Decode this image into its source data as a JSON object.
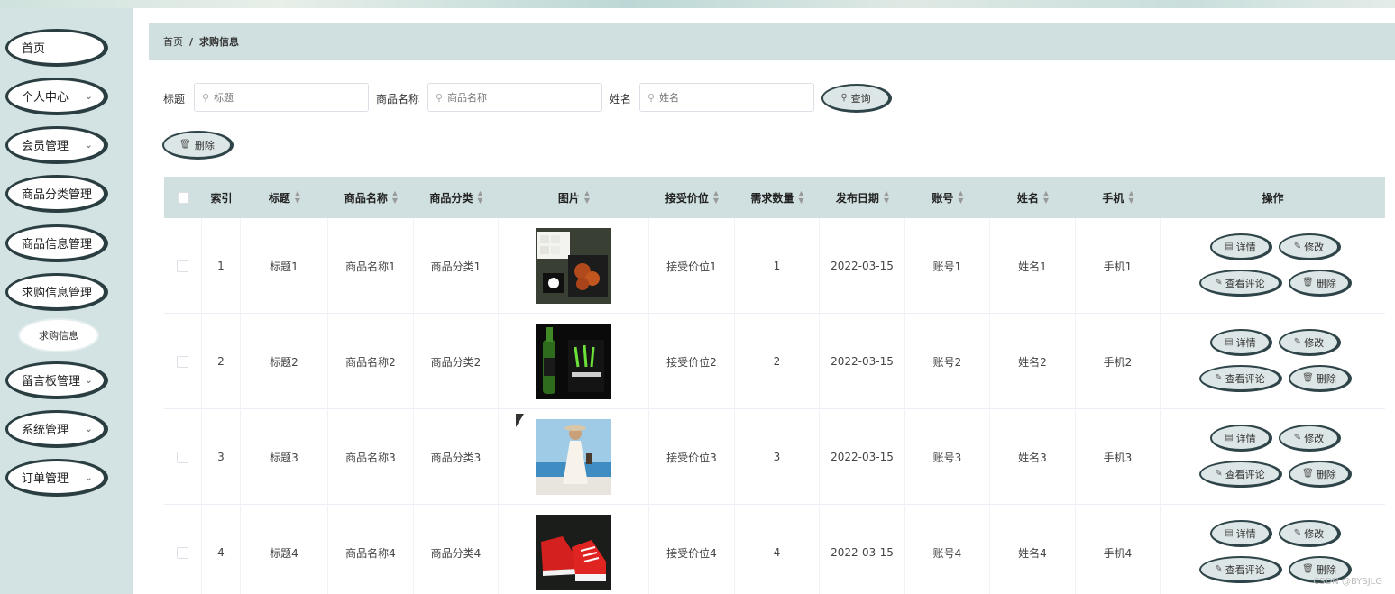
{
  "sidebar": {
    "items": [
      {
        "label": "首页",
        "chevron": false
      },
      {
        "label": "个人中心",
        "chevron": true
      },
      {
        "label": "会员管理",
        "chevron": true
      },
      {
        "label": "商品分类管理",
        "chevron": false
      },
      {
        "label": "商品信息管理",
        "chevron": false
      },
      {
        "label": "求购信息管理",
        "chevron": false
      },
      {
        "label": "留言板管理",
        "chevron": true
      },
      {
        "label": "系统管理",
        "chevron": true
      },
      {
        "label": "订单管理",
        "chevron": true
      }
    ],
    "sub_item": {
      "label": "求购信息"
    }
  },
  "breadcrumb": {
    "home": "首页",
    "separator": "/",
    "current": "求购信息"
  },
  "filters": {
    "title_label": "标题",
    "title_placeholder": "标题",
    "goods_label": "商品名称",
    "goods_placeholder": "商品名称",
    "name_label": "姓名",
    "name_placeholder": "姓名",
    "query_button": "查询"
  },
  "toolbar": {
    "delete_button": "删除"
  },
  "table": {
    "headers": {
      "index": "索引",
      "title": "标题",
      "goods_name": "商品名称",
      "goods_category": "商品分类",
      "image": "图片",
      "accept_price": "接受价位",
      "quantity": "需求数量",
      "date": "发布日期",
      "account": "账号",
      "name": "姓名",
      "phone": "手机",
      "actions": "操作"
    },
    "rows": [
      {
        "index": "1",
        "title": "标题1",
        "goods_name": "商品名称1",
        "goods_category": "商品分类1",
        "image": "food-boxes",
        "accept_price": "接受价位1",
        "quantity": "1",
        "date": "2022-03-15",
        "account": "账号1",
        "name": "姓名1",
        "phone": "手机1"
      },
      {
        "index": "2",
        "title": "标题2",
        "goods_name": "商品名称2",
        "goods_category": "商品分类2",
        "image": "energy-drink-bottle",
        "accept_price": "接受价位2",
        "quantity": "2",
        "date": "2022-03-15",
        "account": "账号2",
        "name": "姓名2",
        "phone": "手机2"
      },
      {
        "index": "3",
        "title": "标题3",
        "goods_name": "商品名称3",
        "goods_category": "商品分类3",
        "image": "woman-white-dress",
        "accept_price": "接受价位3",
        "quantity": "3",
        "date": "2022-03-15",
        "account": "账号3",
        "name": "姓名3",
        "phone": "手机3"
      },
      {
        "index": "4",
        "title": "标题4",
        "goods_name": "商品名称4",
        "goods_category": "商品分类4",
        "image": "red-sneakers",
        "accept_price": "接受价位4",
        "quantity": "4",
        "date": "2022-03-15",
        "account": "账号4",
        "name": "姓名4",
        "phone": "手机4"
      }
    ],
    "row_actions": {
      "detail": "详情",
      "edit": "修改",
      "review": "查看评论",
      "delete": "删除"
    }
  },
  "watermark": "CSDN @BYSJLG",
  "colors": {
    "accent": "#d0e0e0",
    "sidebar_bg": "#d3e3e3",
    "button_bg": "#dde6e6",
    "button_border": "#2e4448"
  }
}
